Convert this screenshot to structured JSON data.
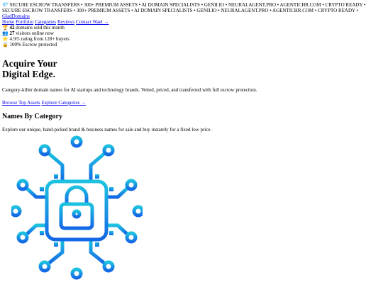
{
  "ticker": {
    "lines": [
      "💎 SECURE ESCROW TRANSFERS  •  300+ PREMIUM ASSETS  •  AI DOMAIN SPECIALISTS  •  GENII.IO  •  NEURALAGENT.PRO  •  AGENTICHR.COM  •  CRYPTO READY  •",
      "SECURE ESCROW TRANSFERS  •  300+ PREMIUM ASSETS  •  AI DOMAIN SPECIALISTS  •  GENII.IO  •  NEURALAGENT.PRO  •  AGENTICHR.COM  •  CRYPTO READY  •"
    ]
  },
  "brand": {
    "link": "GladDomains"
  },
  "nav": {
    "items": [
      "Home",
      "Portfolio",
      "Categories",
      "Reviews",
      "Contact Wael →"
    ]
  },
  "stats": [
    {
      "icon": "🏆",
      "strong": "42",
      "text": " domains sold this month"
    },
    {
      "icon": "👥",
      "strong": "27",
      "text": " visitors online now"
    },
    {
      "icon": "⭐",
      "strong": "",
      "text": "4.9/5 rating from 128+ buyers"
    },
    {
      "icon": "🔒",
      "strong": "",
      "text": "100% Escrow protected"
    }
  ],
  "hero": {
    "title_line1": "Acquire Your",
    "title_line2": "Digital Edge.",
    "lead": "Category-killer domain names for AI startups and technology brands. Vetted, priced, and transferred with full escrow protection.",
    "cta_primary": "Browse Top Assets",
    "cta_secondary": "Explore Categories →"
  },
  "category": {
    "heading": "Names By Category",
    "sub": "Explore our unique, hand-picked brand & business names for sale and buy instantly for a fixed low price."
  },
  "illustration": {
    "icon": "circuit-lock-icon",
    "color_top": "#1cc2e0",
    "color_bottom": "#1468e6"
  }
}
